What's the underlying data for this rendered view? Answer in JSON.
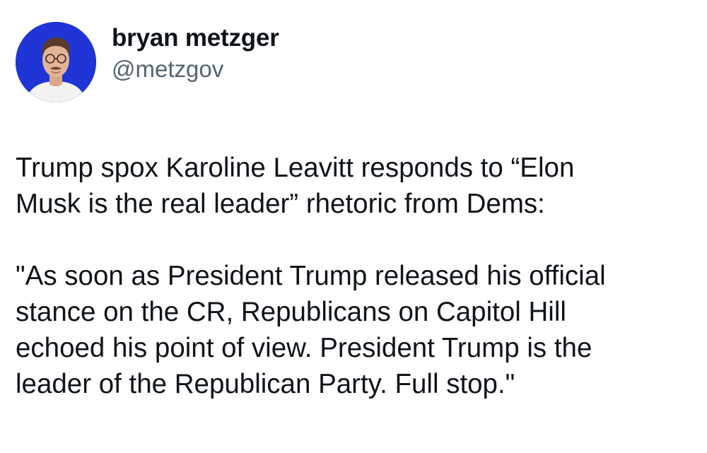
{
  "author": {
    "display_name": "bryan metzger",
    "handle": "@metzgov",
    "avatar_icon": "profile-photo",
    "avatar_bg": "#1f35d6"
  },
  "tweet": {
    "paragraph_1": "Trump spox Karoline Leavitt responds to “Elon\nMusk is the real leader” rhetoric from Dems:",
    "paragraph_2": "\"As soon as President Trump released his official\nstance on the CR, Republicans on Capitol Hill\nechoed his point of view. President Trump is the\nleader of the Republican Party. Full stop.\""
  },
  "colors": {
    "text": "#0f1419",
    "handle": "#536471",
    "background": "#ffffff"
  }
}
